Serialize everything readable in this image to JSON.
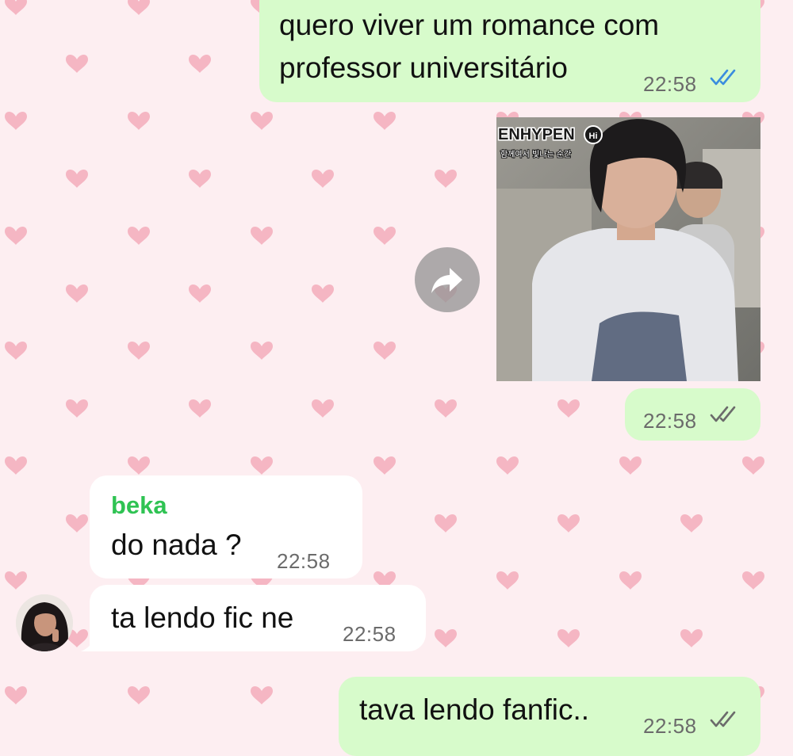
{
  "chat": {
    "messages": [
      {
        "direction": "outgoing",
        "lines": [
          "quero viver um romance com",
          "professor universitário"
        ],
        "time": "22:58",
        "status": "read",
        "tick_color": "#3a8dde"
      },
      {
        "direction": "outgoing",
        "type": "image",
        "image_text": {
          "brand": "ENHYPEN",
          "badge": "Hi",
          "caption": "함께여서 빛나는 순간"
        }
      },
      {
        "direction": "outgoing",
        "time": "22:58",
        "status": "delivered",
        "tick_color": "#6b6b6b"
      },
      {
        "direction": "incoming",
        "sender": "beka",
        "sender_color": "#2fc353",
        "text": "do nada ?",
        "time": "22:58"
      },
      {
        "direction": "incoming",
        "text": "ta lendo fic ne",
        "time": "22:58"
      },
      {
        "direction": "outgoing",
        "text": "tava lendo fanfic..",
        "time": "22:58",
        "status": "delivered",
        "tick_color": "#6b6b6b"
      }
    ]
  },
  "icons": {
    "forward": "forward-arrow-icon",
    "read_receipt": "double-check-icon",
    "avatar": "avatar"
  },
  "colors": {
    "wallpaper": "#fdeef1",
    "heart": "#f5b6c3",
    "outgoing_bubble": "#d7fbcb",
    "incoming_bubble": "#ffffff"
  }
}
